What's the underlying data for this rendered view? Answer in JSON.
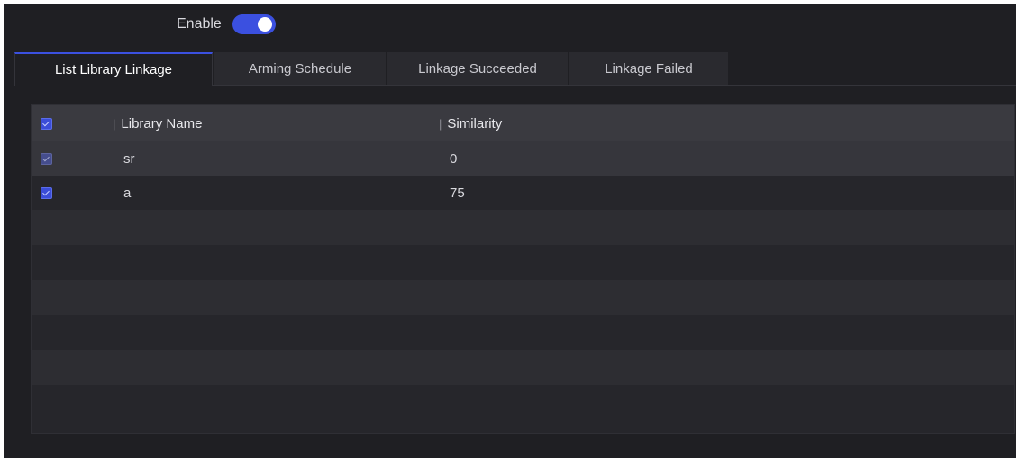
{
  "enable": {
    "label": "Enable",
    "state": "on"
  },
  "tabs": [
    {
      "label": "List Library Linkage",
      "active": true
    },
    {
      "label": "Arming Schedule",
      "active": false
    },
    {
      "label": "Linkage Succeeded",
      "active": false
    },
    {
      "label": "Linkage Failed",
      "active": false
    }
  ],
  "table": {
    "columns": [
      "Library Name",
      "Similarity"
    ],
    "separator": "|",
    "rows": [
      {
        "name": "sr",
        "similarity": "0",
        "checked": true
      },
      {
        "name": "a",
        "similarity": "75",
        "checked": true
      }
    ]
  },
  "colors": {
    "accent": "#3b50e0",
    "background": "#1f1f23",
    "header_row": "#3a3a40"
  },
  "icons": {
    "toggle": "toggle-switch-icon",
    "checkbox": "checkbox-checked-icon"
  }
}
